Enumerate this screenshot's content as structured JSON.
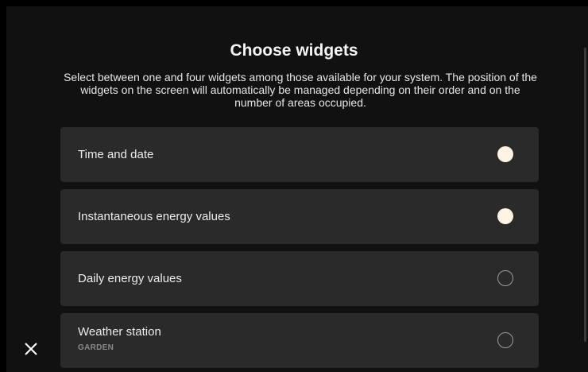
{
  "header": {
    "title": "Choose widgets",
    "subtitle": "Select between one and four widgets among those available for your system. The position of the widgets on the screen will automatically be managed depending on their order and on the number of areas occupied."
  },
  "widgets": [
    {
      "label": "Time and date",
      "sublabel": "",
      "selected": true
    },
    {
      "label": "Instantaneous energy values",
      "sublabel": "",
      "selected": true
    },
    {
      "label": "Daily energy values",
      "sublabel": "",
      "selected": false
    },
    {
      "label": "Weather station",
      "sublabel": "GARDEN",
      "selected": false
    }
  ],
  "icons": {
    "close": "close-icon"
  },
  "colors": {
    "background": "#111111",
    "card": "#2a2a2a",
    "selected_radio": "#fff4e1",
    "unselected_radio_border": "#9a9a9a"
  }
}
